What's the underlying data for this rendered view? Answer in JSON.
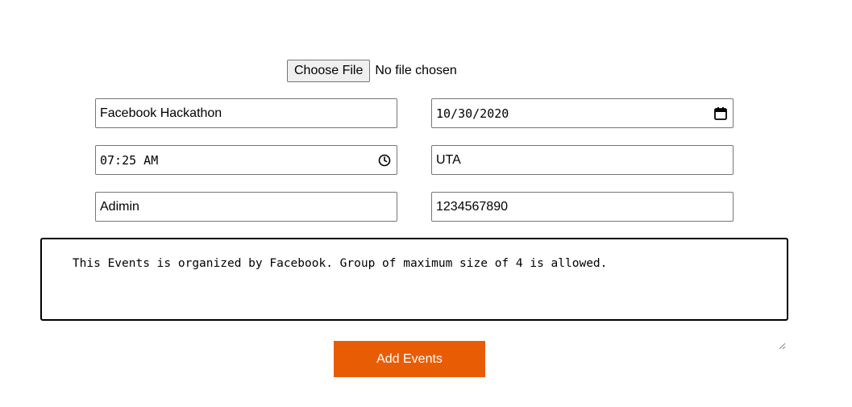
{
  "file_input": {
    "button_label": "Choose File",
    "status": "No file chosen"
  },
  "form": {
    "event_name": "Facebook Hackathon",
    "date": "10/30/2020",
    "time": "07:25 AM",
    "location": "UTA",
    "organizer": "Adimin",
    "phone": "1234567890",
    "description": "This Events is organized by Facebook. Group of maximum size of 4 is allowed."
  },
  "submit": {
    "label": "Add Events",
    "color": "#e85d04"
  },
  "icons": {
    "date": "calendar-icon",
    "time": "clock-icon",
    "textarea": "resize-grip-icon"
  }
}
